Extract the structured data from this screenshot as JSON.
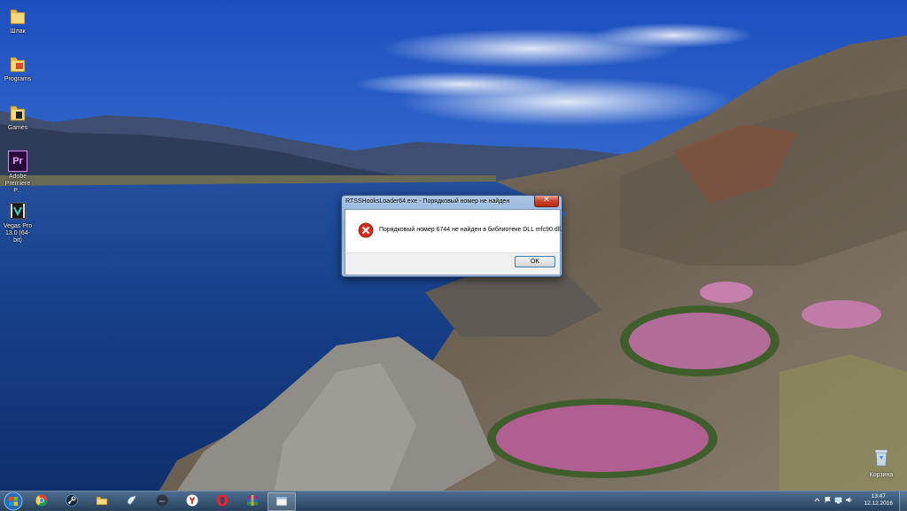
{
  "desktop": {
    "icons": [
      {
        "label": "Шлак",
        "icon": "folder-icon"
      },
      {
        "label": "Programs",
        "icon": "folder-icon"
      },
      {
        "label": "Games",
        "icon": "folder-icon"
      },
      {
        "label": "Adobe Premiere P...",
        "icon": "premiere-icon",
        "glyph_text": "Pr"
      },
      {
        "label": "Vegas Pro 13.0 (64-bit)",
        "icon": "vegas-icon"
      }
    ],
    "recycle_bin": {
      "label": "Корзина",
      "icon": "recycle-bin-icon"
    }
  },
  "dialog": {
    "title": "RTSSHooksLoader64.exe - Порядковый номер не найден",
    "message": "Порядковый номер 6744 не найден в библиотеке DLL mfc90.dll.",
    "ok_label": "OK",
    "icon": "error-icon"
  },
  "taskbar": {
    "apps": [
      {
        "name": "chrome",
        "icon": "chrome-icon"
      },
      {
        "name": "steam",
        "icon": "steam-icon"
      },
      {
        "name": "explorer",
        "icon": "folder-icon"
      },
      {
        "name": "malwarebytes",
        "icon": "malwarebytes-icon"
      },
      {
        "name": "nox",
        "icon": "nox-icon"
      },
      {
        "name": "yandex",
        "icon": "yandex-icon"
      },
      {
        "name": "opera",
        "icon": "opera-icon"
      },
      {
        "name": "winrar",
        "icon": "winrar-icon"
      },
      {
        "name": "active-window",
        "icon": "window-icon",
        "active": true
      }
    ],
    "clock": {
      "time": "13:47",
      "date": "12.12.2016"
    }
  },
  "colors": {
    "taskbar": "#2d4a66",
    "dialog_frame": "#9bb9dd",
    "error_red": "#d32b1e",
    "close_red": "#c7422a"
  }
}
